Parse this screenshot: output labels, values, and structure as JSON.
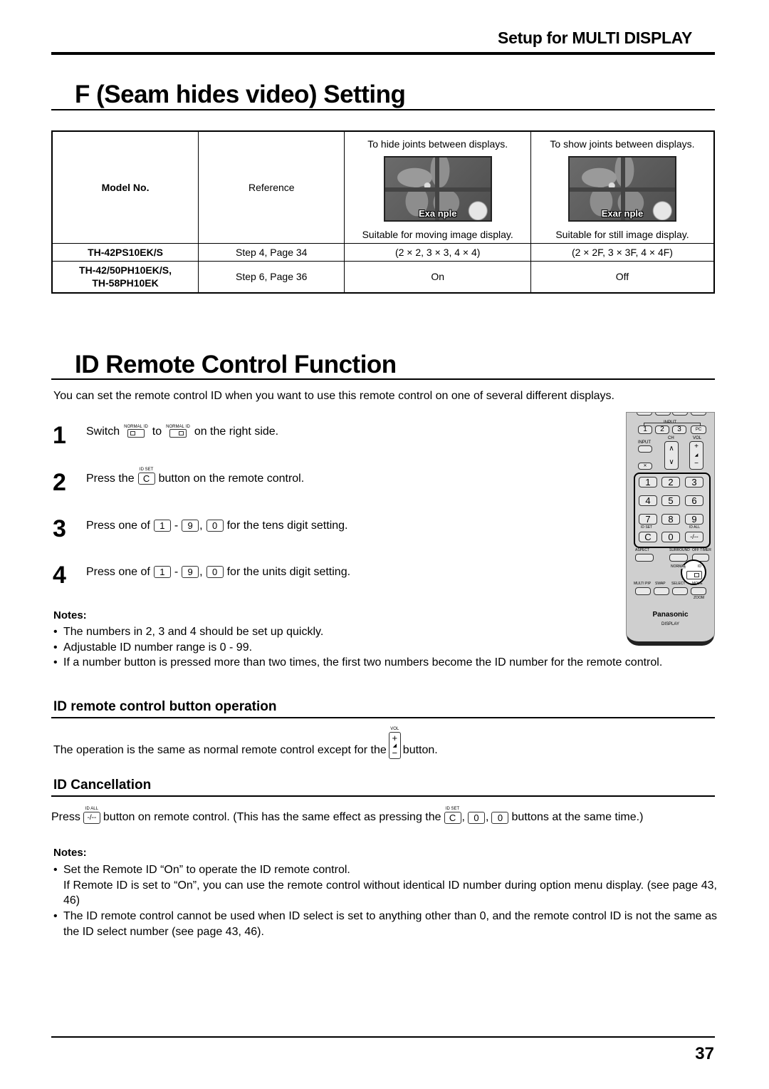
{
  "header": {
    "section_title": "Setup for MULTI DISPLAY"
  },
  "seam_section": {
    "title": "F (Seam hides video) Setting",
    "table": {
      "headers": {
        "model": "Model No.",
        "reference": "Reference",
        "hide": {
          "caption_top": "To hide joints between displays.",
          "image_label": "Exa  nple",
          "caption_bottom": "Suitable for moving image display."
        },
        "show": {
          "caption_top": "To show joints between displays.",
          "image_label": "Exar  nple",
          "caption_bottom": "Suitable for still image display."
        }
      },
      "rows": [
        {
          "model": "TH-42PS10EK/S",
          "model2": "",
          "reference": "Step 4, Page 34",
          "hide": "(2 × 2, 3 × 3, 4 × 4)",
          "show": "(2 × 2F, 3 × 3F, 4 × 4F)"
        },
        {
          "model": "TH-42/50PH10EK/S,",
          "model2": "TH-58PH10EK",
          "reference": "Step 6, Page 36",
          "hide": "On",
          "show": "Off"
        }
      ]
    }
  },
  "id_section": {
    "title": "ID Remote Control Function",
    "intro": "You can set the remote control ID when you want to use this remote control on one of several different displays.",
    "steps": [
      {
        "num": "1",
        "a": "Switch",
        "b": "to",
        "c": "on the right side."
      },
      {
        "num": "2",
        "a": "Press the",
        "b": "button on the remote control."
      },
      {
        "num": "3",
        "a": "Press one of",
        "b": "-",
        "c": ",",
        "d": "for the tens digit setting."
      },
      {
        "num": "4",
        "a": "Press one of",
        "b": "-",
        "c": ",",
        "d": "for the units digit setting."
      }
    ],
    "keys": {
      "normal_label": "NORMAL",
      "id_label": "ID",
      "id_set_label": "ID SET",
      "id_all_label": "ID ALL",
      "vol_label": "VOL",
      "c": "C",
      "one": "1",
      "nine": "9",
      "zero": "0",
      "dash": "-/--",
      "plus": "+",
      "mid": "◢",
      "minus": "−"
    },
    "notes_label": "Notes:",
    "notes": [
      "The numbers in 2, 3 and 4 should be set up quickly.",
      "Adjustable ID number range is 0 - 99.",
      "If a number button is pressed more than two times, the first two numbers become the ID number for the remote control."
    ],
    "bullet": "•"
  },
  "button_operation": {
    "title": "ID remote control button operation",
    "text_a": "The operation is the same as normal remote control except for the",
    "text_b": "button."
  },
  "cancellation": {
    "title": "ID Cancellation",
    "text_a": "Press",
    "text_b": "button on remote control. (This has the same effect as pressing the",
    "comma": ",",
    "text_c": "buttons at the same time.)",
    "notes_label": "Notes:",
    "notes": [
      "Set the Remote ID “On” to operate the ID remote control.",
      "The ID remote control cannot be used when ID select is set to anything other than 0, and the remote control ID is not the same as the ID select number (see page 43, 46)."
    ],
    "note1_cont": "If Remote ID is set to “On”, you can use the remote control without identical ID number during option menu display. (see page 43, 46)"
  },
  "remote": {
    "input_group_label": "INPUT",
    "input_buttons": [
      "1",
      "2",
      "3",
      "PC"
    ],
    "input_label": "INPUT",
    "ch_label": "CH",
    "vol_label": "VOL",
    "ch_up": "∧",
    "ch_down": "∨",
    "vol_plus": "+",
    "vol_mid": "◢",
    "vol_minus": "−",
    "mute": "🔇",
    "numbers": [
      "1",
      "2",
      "3",
      "4",
      "5",
      "6",
      "7",
      "8",
      "9"
    ],
    "id_set": "ID SET",
    "id_all": "ID ALL",
    "c": "C",
    "zero": "0",
    "dash": "-/--",
    "aspect": "ASPECT",
    "surround": "SURROUND",
    "off_timer": "OFF TIMER",
    "normal": "NORMAL",
    "id": "ID",
    "multi_pip": "MULTI PIP",
    "swap": "SWAP",
    "select": "SELECT",
    "move": "MOVE",
    "zoom": "ZOOM",
    "brand": "Panasonic",
    "brand_sub": "DISPLAY"
  },
  "footer": {
    "page_number": "37"
  }
}
